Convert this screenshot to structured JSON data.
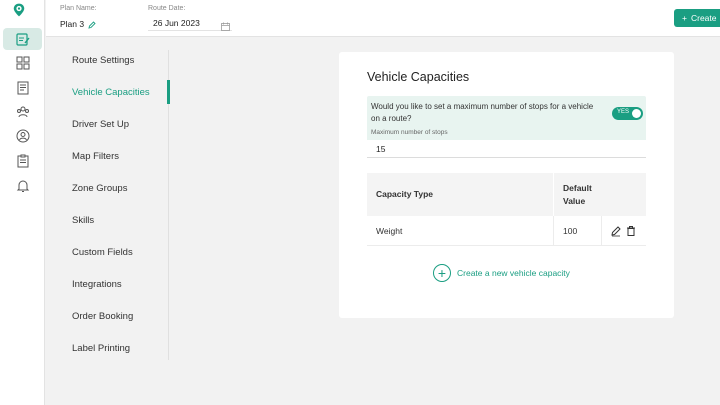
{
  "header": {
    "plan_name_label": "Plan Name:",
    "plan_name_value": "Plan 3",
    "route_date_label": "Route Date:",
    "route_date_value": "26 Jun 2023",
    "create_label": "Create"
  },
  "rail": {
    "icons": [
      "logo-pin-icon",
      "route-planner-icon",
      "dashboard-icon",
      "reports-icon",
      "team-icon",
      "profile-icon",
      "clipboard-icon",
      "notifications-icon"
    ],
    "active": "route-planner-icon"
  },
  "settings_nav": {
    "items": [
      {
        "label": "Route Settings"
      },
      {
        "label": "Vehicle Capacities"
      },
      {
        "label": "Driver Set Up"
      },
      {
        "label": "Map Filters"
      },
      {
        "label": "Zone Groups"
      },
      {
        "label": "Skills"
      },
      {
        "label": "Custom Fields"
      },
      {
        "label": "Integrations"
      },
      {
        "label": "Order Booking"
      },
      {
        "label": "Label Printing"
      }
    ],
    "active_index": 1
  },
  "vehicle_capacities": {
    "title": "Vehicle Capacities",
    "max_stops_question": "Would you like to set a maximum number of stops for a vehicle on a route?",
    "toggle_label": "YES",
    "max_stops_label": "Maximum number of stops",
    "max_stops_value": "15",
    "table": {
      "headers": [
        "Capacity Type",
        "Default Value"
      ],
      "rows": [
        {
          "type": "Weight",
          "value": "100"
        }
      ]
    },
    "add_link_label": "Create a new vehicle capacity"
  },
  "colors": {
    "accent": "#1a9e82",
    "accent_light": "#e8f4f0",
    "background": "#f2f2f2"
  }
}
